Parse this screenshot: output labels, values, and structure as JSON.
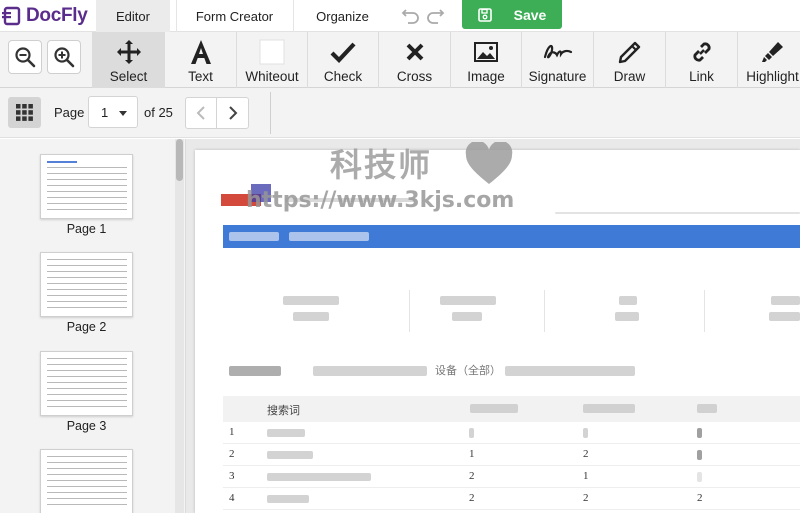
{
  "app": {
    "name": "DocFly"
  },
  "tabs": [
    {
      "label": "Editor",
      "active": true
    },
    {
      "label": "Form Creator",
      "active": false
    },
    {
      "label": "Organize",
      "active": false
    }
  ],
  "actions": {
    "save_label": "Save"
  },
  "tools": [
    {
      "label": "Select",
      "icon": "move-icon",
      "active": true
    },
    {
      "label": "Text",
      "icon": "text-a-icon"
    },
    {
      "label": "Whiteout",
      "icon": "whiteout-box-icon"
    },
    {
      "label": "Check",
      "icon": "check-icon"
    },
    {
      "label": "Cross",
      "icon": "cross-icon"
    },
    {
      "label": "Image",
      "icon": "image-icon"
    },
    {
      "label": "Signature",
      "icon": "signature-icon"
    },
    {
      "label": "Draw",
      "icon": "pencil-icon"
    },
    {
      "label": "Link",
      "icon": "link-icon"
    },
    {
      "label": "Highlight",
      "icon": "highlighter-icon"
    }
  ],
  "pager": {
    "page_label": "Page",
    "current_page": "1",
    "of_label": "of 25"
  },
  "thumbnails": [
    {
      "label": "Page 1"
    },
    {
      "label": "Page 2"
    },
    {
      "label": "Page 3"
    },
    {
      "label": ""
    }
  ],
  "document": {
    "table_header_keyword": "搜索词",
    "table_context": "设备（全部）",
    "rows": [
      {
        "num": "1",
        "c2": "",
        "c3": "",
        "c4": ""
      },
      {
        "num": "2",
        "c2": "1",
        "c3": "2",
        "c4": ""
      },
      {
        "num": "3",
        "c2": "2",
        "c3": "1",
        "c4": ""
      },
      {
        "num": "4",
        "c2": "2",
        "c3": "2",
        "c4": "2"
      }
    ]
  },
  "watermark": {
    "text": "科技师",
    "url": "https://www.3kjs.com"
  },
  "colors": {
    "brand": "#5a2d8c",
    "save": "#3dae55",
    "doc_banner": "#3f7bd6"
  }
}
